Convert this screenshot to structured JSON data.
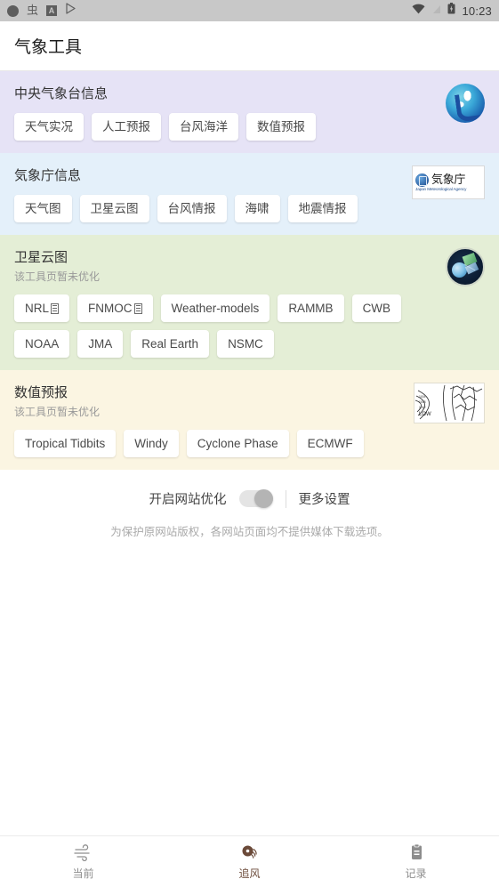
{
  "statusbar": {
    "time": "10:23",
    "icons_left": [
      "circle-dot-icon",
      "bug-icon",
      "boxed-a-icon",
      "play-store-icon"
    ],
    "icons_right": [
      "wifi-icon",
      "signal-icon",
      "battery-charging-icon"
    ],
    "boxed_a_text": "A"
  },
  "appbar": {
    "title": "气象工具"
  },
  "sections": [
    {
      "key": "cma",
      "title": "中央气象台信息",
      "subtitle": "",
      "logo": "cma-dragon-logo",
      "bg": "#e6e3f6",
      "chips": [
        {
          "label": "天气实况"
        },
        {
          "label": "人工预报"
        },
        {
          "label": "台风海洋"
        },
        {
          "label": "数值预报"
        }
      ]
    },
    {
      "key": "jma",
      "title": "気象庁信息",
      "subtitle": "",
      "logo": "jma-logo",
      "bg": "#e4f0fa",
      "logo_text": "気象庁",
      "logo_subtext": "Japan Meteorological Agency",
      "chips": [
        {
          "label": "天气图"
        },
        {
          "label": "卫星云图"
        },
        {
          "label": "台风情报"
        },
        {
          "label": "海啸"
        },
        {
          "label": "地震情报"
        }
      ]
    },
    {
      "key": "satellite",
      "title": "卫星云图",
      "subtitle": "该工具页暂未优化",
      "logo": "satellite-earth-logo",
      "bg": "#e4eed6",
      "chips": [
        {
          "label": "NRL",
          "tofu": true
        },
        {
          "label": "FNMOC",
          "tofu": true
        },
        {
          "label": "Weather-models"
        },
        {
          "label": "RAMMB"
        },
        {
          "label": "CWB"
        },
        {
          "label": "NOAA"
        },
        {
          "label": "JMA"
        },
        {
          "label": "Real Earth"
        },
        {
          "label": "NSMC"
        }
      ]
    },
    {
      "key": "nwp",
      "title": "数值预报",
      "subtitle": "该工具页暂未优化",
      "logo": "isobar-chart-logo",
      "bg": "#fbf5e2",
      "chips": [
        {
          "label": "Tropical Tidbits"
        },
        {
          "label": "Windy"
        },
        {
          "label": "Cyclone Phase"
        },
        {
          "label": "ECMWF"
        }
      ]
    }
  ],
  "settings": {
    "optimize_label": "开启网站优化",
    "optimize_enabled": true,
    "more_settings_label": "更多设置",
    "disclaimer": "为保护原网站版权，各网站页面均不提供媒体下载选项。"
  },
  "bottom_nav": {
    "items": [
      {
        "label": "当前",
        "icon": "wind-icon",
        "active": false
      },
      {
        "label": "追风",
        "icon": "cyclone-icon",
        "active": true
      },
      {
        "label": "记录",
        "icon": "clipboard-icon",
        "active": false
      }
    ]
  }
}
